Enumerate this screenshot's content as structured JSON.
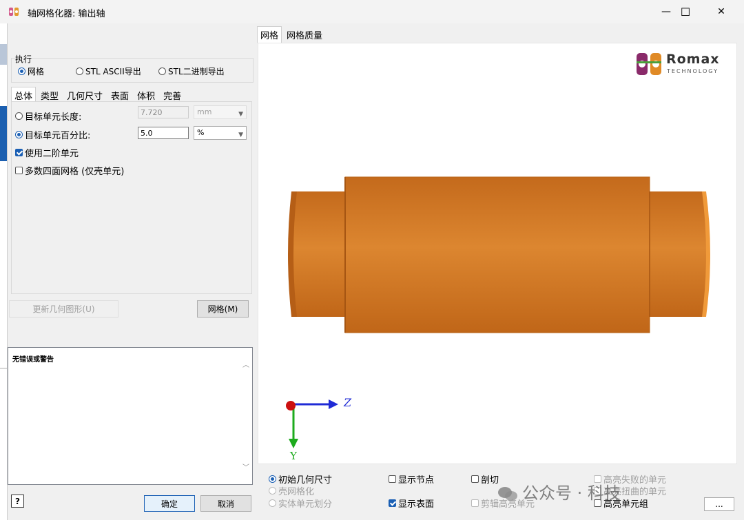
{
  "window": {
    "title": "轴网格化器: 输出轴",
    "minimize_glyph": "—",
    "maximize_glyph": "☐",
    "close_glyph": "✕"
  },
  "execute": {
    "group_label": "执行",
    "options": [
      {
        "label": "网格",
        "selected": true
      },
      {
        "label": "STL ASCII导出",
        "selected": false
      },
      {
        "label": "STL二进制导出",
        "selected": false
      }
    ]
  },
  "left_tabs": [
    "总体",
    "类型",
    "几何尺寸",
    "表面",
    "体积",
    "完善"
  ],
  "general": {
    "target_length_label": "目标单元长度:",
    "target_length_value": "7.720",
    "target_length_unit": "mm",
    "target_percent_label": "目标单元百分比:",
    "target_percent_value": "5.0",
    "target_percent_unit": "%",
    "second_order_label": "使用二阶单元",
    "quad_mesh_label": "多数四面网格 (仅壳单元)"
  },
  "buttons": {
    "update_geometry": "更新几何图形(U)",
    "mesh": "网格(M)",
    "help": "?",
    "ok": "确定",
    "cancel": "取消",
    "more": "..."
  },
  "messages": {
    "text": "无错误或警告"
  },
  "right_tabs": [
    "网格",
    "网格质量"
  ],
  "logo": {
    "brand": "Romax",
    "sub": "TECHNOLOGY"
  },
  "axes": {
    "z_label": "Z",
    "y_label": "Y"
  },
  "view_options": {
    "col1": [
      {
        "label": "初始几何尺寸",
        "type": "radio",
        "checked": true,
        "enabled": true
      },
      {
        "label": "壳网格化",
        "type": "radio",
        "checked": false,
        "enabled": false
      },
      {
        "label": "实体单元划分",
        "type": "radio",
        "checked": false,
        "enabled": false
      }
    ],
    "col2": [
      {
        "label": "显示节点",
        "type": "check",
        "checked": false,
        "enabled": true
      },
      {
        "label": "显示表面",
        "type": "check",
        "checked": true,
        "enabled": true
      }
    ],
    "col3": [
      {
        "label": "剖切",
        "type": "check",
        "checked": false,
        "enabled": true
      },
      {
        "label": "剪辑高亮单元",
        "type": "check",
        "checked": false,
        "enabled": false
      }
    ],
    "col4": [
      {
        "label": "高亮失败的单元",
        "type": "check",
        "checked": false,
        "enabled": false
      },
      {
        "label": "高亮扭曲的单元",
        "type": "check",
        "checked": false,
        "enabled": false
      },
      {
        "label": "高亮单元组",
        "type": "check",
        "checked": false,
        "enabled": true
      }
    ]
  },
  "watermark": "公众号 · 科技",
  "colors": {
    "shaft": "#d37a24",
    "accent": "#1a5fb4",
    "axis_z": "#1f2bd6",
    "axis_y": "#1dab1d",
    "origin": "#cc1010"
  }
}
